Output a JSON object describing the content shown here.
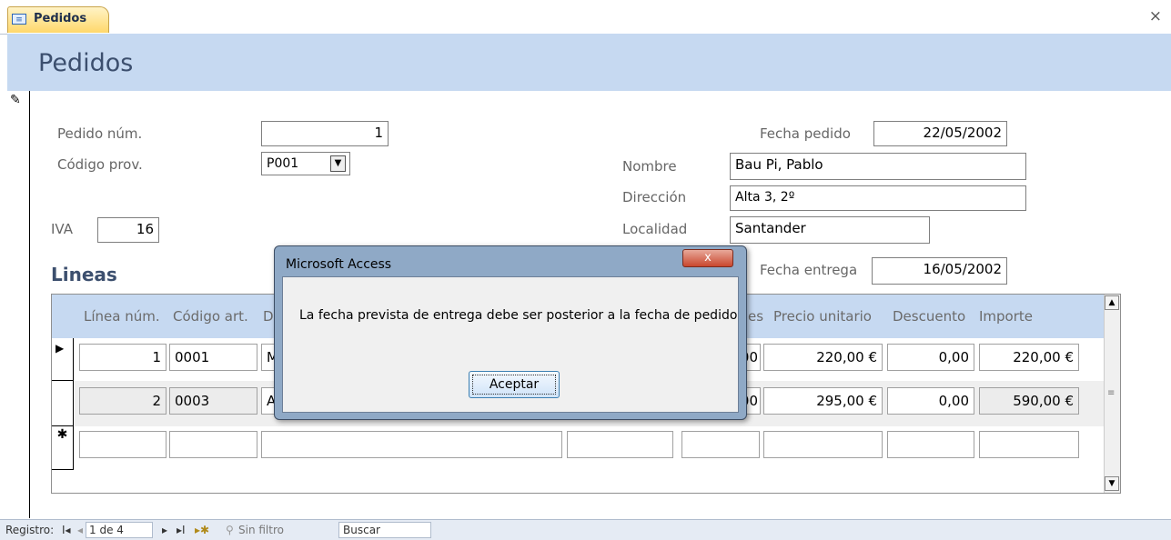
{
  "tab": {
    "label": "Pedidos",
    "icon": "form-icon",
    "close": "×"
  },
  "header": {
    "title": "Pedidos"
  },
  "form": {
    "record_selector_icon": "pencil-icon",
    "pedido_num": {
      "label": "Pedido núm.",
      "value": "1"
    },
    "codigo_prov": {
      "label": "Código prov.",
      "value": "P001"
    },
    "iva": {
      "label": "IVA",
      "value": "16"
    },
    "fecha_pedido": {
      "label": "Fecha pedido",
      "value": "22/05/2002"
    },
    "nombre": {
      "label": "Nombre",
      "value": "Bau Pi, Pablo"
    },
    "direccion": {
      "label": "Dirección",
      "value": "Alta 3, 2º"
    },
    "localidad": {
      "label": "Localidad",
      "value": "Santander"
    },
    "fecha_entrega": {
      "label": "Fecha entrega",
      "value": "16/05/2002"
    }
  },
  "lineas": {
    "title": "Lineas",
    "columns": {
      "linea_num": "Línea núm.",
      "codigo_art": "Código art.",
      "descripcion_partial": "D",
      "unidades_partial": "es",
      "precio_unitario": "Precio unitario",
      "descuento": "Descuento",
      "importe": "Importe"
    },
    "rows": [
      {
        "selector": "▶",
        "linea": "1",
        "codigo": "0001",
        "desc": "M",
        "unidades": "00",
        "precio": "220,00 €",
        "descuento": "0,00",
        "importe": "220,00 €"
      },
      {
        "selector": "",
        "linea": "2",
        "codigo": "0003",
        "desc": "A",
        "unidades": "00",
        "precio": "295,00 €",
        "descuento": "0,00",
        "importe": "590,00 €"
      }
    ],
    "new_row_selector": "✱"
  },
  "statusbar": {
    "registro_label": "Registro:",
    "first": "I◂",
    "prev": "◂",
    "position": "1 de 4",
    "next": "▸",
    "last": "▸I",
    "new": "▸✱",
    "filter": "Sin filtro",
    "search": "Buscar"
  },
  "dialog": {
    "title": "Microsoft Access",
    "close": "x",
    "message": "La fecha prevista de entrega debe ser posterior a la fecha de pedido",
    "ok_label": "Aceptar"
  },
  "colors": {
    "header_bg": "#c6d9f1",
    "tab_bg": "#ffd86b",
    "dialog_frame": "#8fa9c6"
  }
}
